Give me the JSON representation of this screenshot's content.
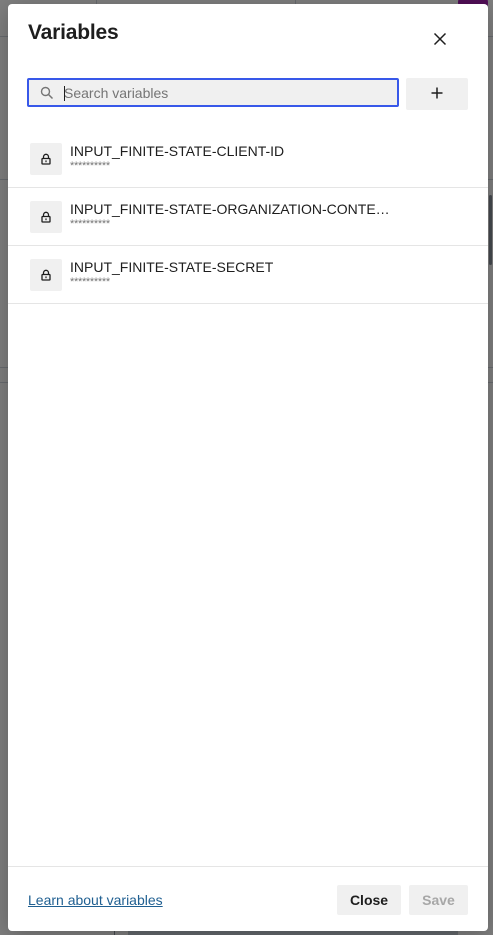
{
  "dialog": {
    "title": "Variables",
    "close_icon": "close-icon"
  },
  "search": {
    "placeholder": "Search variables",
    "value": "",
    "icon": "search-icon"
  },
  "toolbar": {
    "add_icon": "plus-icon"
  },
  "variables": [
    {
      "name": "INPUT_FINITE-STATE-CLIENT-ID",
      "value": "**********",
      "icon": "lock-icon"
    },
    {
      "name": "INPUT_FINITE-STATE-ORGANIZATION-CONTE…",
      "value": "**********",
      "icon": "lock-icon"
    },
    {
      "name": "INPUT_FINITE-STATE-SECRET",
      "value": "**********",
      "icon": "lock-icon"
    }
  ],
  "footer": {
    "learn_link": "Learn about variables",
    "close_label": "Close",
    "save_label": "Save"
  },
  "colors": {
    "accent": "#3858e9",
    "link": "#1f5f91",
    "overlay": "#000000",
    "avatar": "#a21caf"
  }
}
